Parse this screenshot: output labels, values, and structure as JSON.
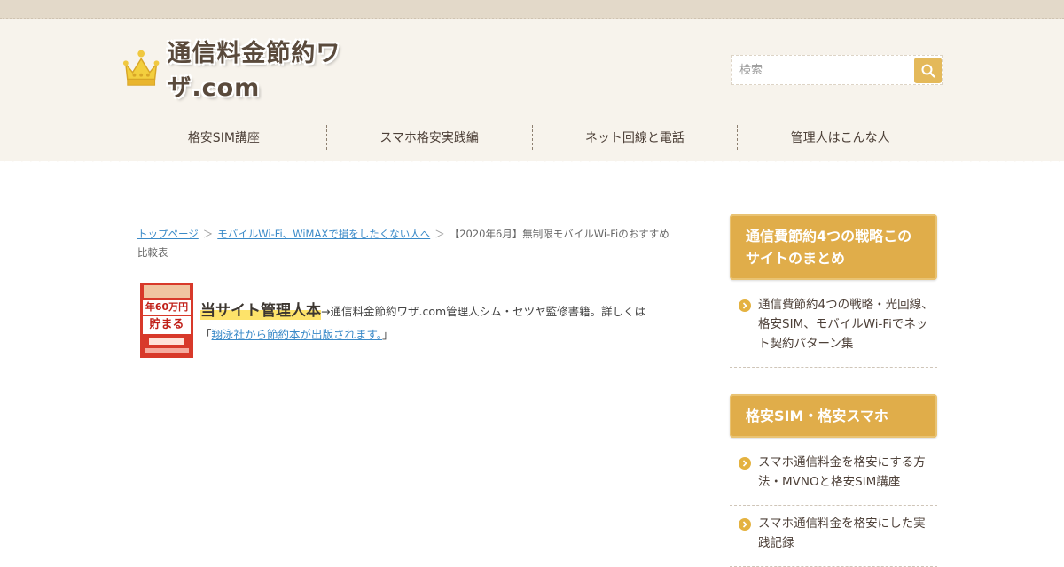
{
  "site": {
    "logo_text": "通信料金節約ワザ.com"
  },
  "search": {
    "placeholder": "検索"
  },
  "nav": {
    "items": [
      "格安SIM講座",
      "スマホ格安実践編",
      "ネット回線と電話",
      "管理人はこんな人"
    ]
  },
  "breadcrumb": {
    "home": "トップページ",
    "category": "モバイルWi-Fi、WiMAXで損をしたくない人へ",
    "current": "【2020年6月】無制限モバイルWi-Fiのおすすめ比較表",
    "separator": "＞"
  },
  "book": {
    "tag": "年60万円",
    "title": "貯まる"
  },
  "promo": {
    "highlight": "当サイト管理人本",
    "text": "→通信料金節約ワザ.com管理人シム・セツヤ監修書籍。詳しくは",
    "open_quote": "「",
    "link": "翔泳社から節約本が出版されます。",
    "close_quote": "」"
  },
  "sidebar": {
    "sections": [
      {
        "heading": "通信費節約4つの戦略このサイトのまとめ",
        "items": [
          "通信費節約4つの戦略・光回線、格安SIM、モバイルWi-Fiでネット契約パターン集"
        ]
      },
      {
        "heading": "格安SIM・格安スマホ",
        "items": [
          "スマホ通信料金を格安にする方法・MVNOと格安SIM講座",
          "スマホ通信料金を格安にした実践記録"
        ]
      }
    ]
  },
  "colors": {
    "accent": "#e0ad4a",
    "link": "#3a8ac8",
    "header_bg": "#f7f3ec"
  }
}
